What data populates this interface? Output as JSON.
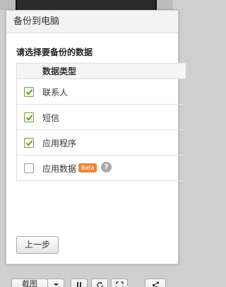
{
  "dialog": {
    "title": "备份到电脑",
    "instruction": "请选择要备份的数据",
    "table_header": "数据类型",
    "rows": [
      {
        "label": "联系人",
        "checked": true
      },
      {
        "label": "短信",
        "checked": true
      },
      {
        "label": "应用程序",
        "checked": true
      },
      {
        "label": "应用数据",
        "checked": false,
        "badge": "Beta",
        "help": "?"
      }
    ],
    "prev_button": "上一步"
  },
  "toolbar": {
    "screenshot_label": "截图"
  },
  "colors": {
    "check_green": "#6b9a26",
    "beta_orange": "#e8883a"
  }
}
